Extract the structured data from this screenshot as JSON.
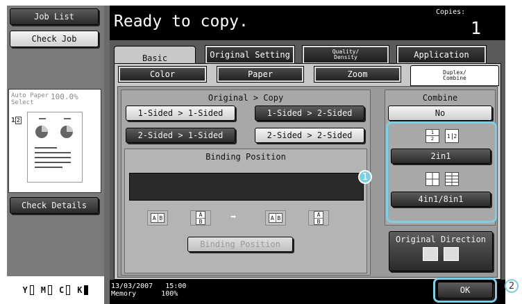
{
  "left": {
    "job_list": "Job List",
    "check_job": "Check Job",
    "auto_paper": "Auto Paper",
    "select": "Select",
    "zoom": "100.0%",
    "page_count": "1",
    "page_total": "2",
    "check_details": "Check Details",
    "toner": [
      "Y",
      "M",
      "C",
      "K"
    ]
  },
  "header": {
    "title": "Ready to copy.",
    "copies_label": "Copies:",
    "copies_value": "1"
  },
  "tabs": {
    "basic": "Basic",
    "original_setting": "Original Setting",
    "quality_1": "Quality/",
    "quality_2": "Density",
    "application": "Application"
  },
  "subtabs": {
    "color": "Color",
    "paper": "Paper",
    "zoom": "Zoom",
    "duplex_1": "Duplex/",
    "duplex_2": "Combine"
  },
  "original_copy": {
    "title": "Original > Copy",
    "opt1": "1-Sided > 1-Sided",
    "opt2": "1-Sided > 2-Sided",
    "opt3": "2-Sided > 1-Sided",
    "opt4": "2-Sided > 2-Sided"
  },
  "binding": {
    "title": "Binding Position",
    "button": "Binding Position",
    "a": "A",
    "b": "B"
  },
  "combine": {
    "title": "Combine",
    "no": "No",
    "two_in_one": "2in1",
    "four_eight": "4in1/8in1",
    "one": "1",
    "two": "2"
  },
  "original_direction": "Original Direction",
  "ok": "OK",
  "callouts": [
    "1",
    "2"
  ],
  "footer": {
    "date": "13/03/2007",
    "time": "15:00",
    "memory_label": "Memory",
    "memory_value": "100%"
  },
  "colors": {
    "highlight": "#7cd0e6"
  }
}
